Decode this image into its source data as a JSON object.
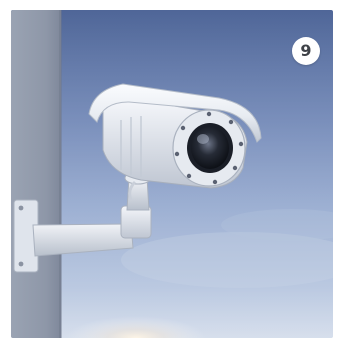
{
  "badge": {
    "number": "9",
    "background": "#ffffff",
    "text_color": "#3f4248"
  },
  "photo": {
    "subject": "security-camera-icon",
    "sky_colors": [
      "#4f6698",
      "#8ea4cc",
      "#c9d4e6"
    ],
    "wall_color": "#8f98a8",
    "camera_color": "#eef1f5"
  }
}
